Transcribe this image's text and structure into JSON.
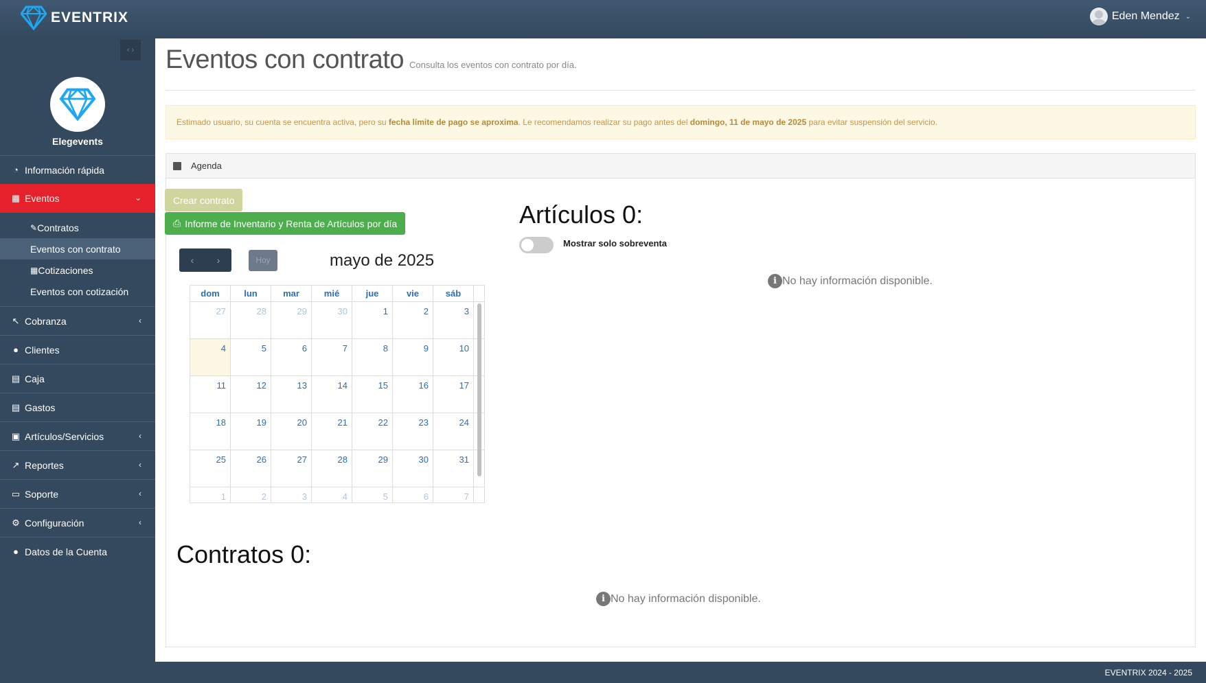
{
  "app": {
    "brand": "EVENTRIX",
    "user": "Eden Mendez"
  },
  "sidebar": {
    "profile_name": "Elegevents",
    "menu": [
      {
        "label": "Información rápida",
        "icon": "dashboard-icon"
      },
      {
        "label": "Eventos",
        "icon": "calendar-icon",
        "active": true
      },
      {
        "label": "Cobranza",
        "icon": "pointer-icon"
      },
      {
        "label": "Clientes",
        "icon": "users-icon"
      },
      {
        "label": "Caja",
        "icon": "cash-register-icon"
      },
      {
        "label": "Gastos",
        "icon": "receipt-icon"
      },
      {
        "label": "Artículos/Servicios",
        "icon": "box-icon"
      },
      {
        "label": "Reportes",
        "icon": "chart-line-icon"
      },
      {
        "label": "Soporte",
        "icon": "support-icon"
      },
      {
        "label": "Configuración",
        "icon": "gear-icon"
      },
      {
        "label": "Datos de la Cuenta",
        "icon": "user-cog-icon"
      }
    ],
    "submenu": [
      {
        "label": "Contratos",
        "icon": "contract-icon"
      },
      {
        "label": "Eventos con contrato",
        "active": true
      },
      {
        "label": "Cotizaciones",
        "icon": "calculator-icon"
      },
      {
        "label": "Eventos con cotización"
      }
    ]
  },
  "page": {
    "title": "Eventos con contrato",
    "subtitle": "Consulta los eventos con contrato por día."
  },
  "alert": {
    "part1": "Estimado usuario, su cuenta se encuentra activa, pero su ",
    "bold1": "fecha límite de pago se aproxima",
    "part2": ". Le recomendamos realizar su pago antes del ",
    "bold2": "domingo, 11 de mayo de 2025",
    "part3": " para evitar suspensión del servicio."
  },
  "agenda": {
    "panel_title": "Agenda",
    "create_button": "Crear contrato",
    "report_button": "Informe de Inventario y Renta de Artículos por día",
    "today_button": "Hoy",
    "calendar_title": "mayo de 2025",
    "weekdays": [
      "dom",
      "lun",
      "mar",
      "mié",
      "jue",
      "vie",
      "sáb"
    ]
  },
  "articulos": {
    "title": "Artículos 0:",
    "toggle_label": "Mostrar solo sobreventa",
    "empty": "No hay información disponible."
  },
  "contratos": {
    "title": "Contratos 0:",
    "empty": "No hay información disponible."
  },
  "footer": {
    "text": "EVENTRIX 2024 - 2025"
  },
  "colors": {
    "sidebar": "#34495e",
    "active": "#e5212c",
    "accent_green": "#4cae4c"
  }
}
